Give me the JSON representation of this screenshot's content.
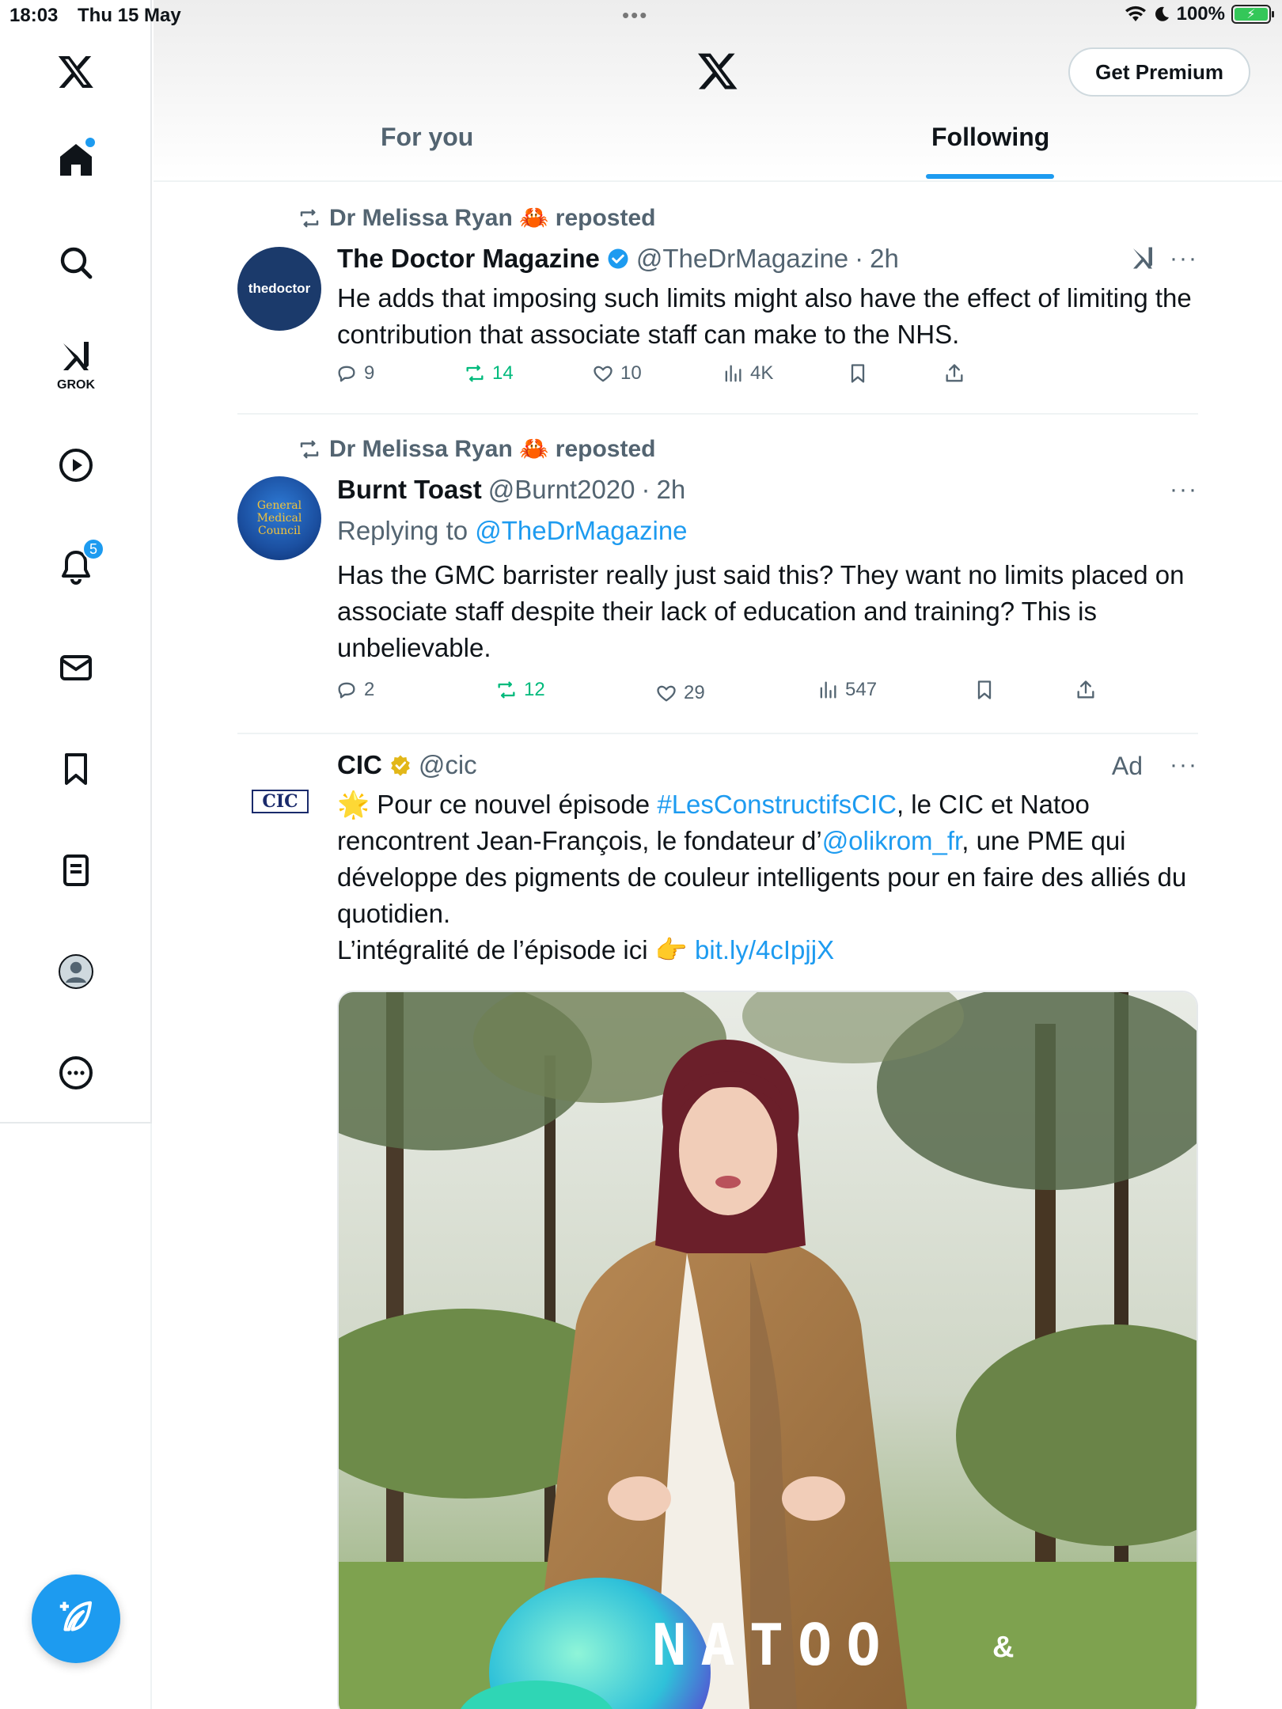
{
  "status_bar": {
    "time": "18:03",
    "date": "Thu 15 May",
    "battery": "100%"
  },
  "nav": {
    "grok_label": "GROK",
    "notifications_count": "5"
  },
  "header": {
    "premium_label": "Get Premium",
    "tabs": [
      {
        "label": "For you",
        "active": false
      },
      {
        "label": "Following",
        "active": true
      }
    ]
  },
  "tweets": [
    {
      "reposted_by": "Dr Melissa Ryan 🦀 reposted",
      "avatar_text": "thedoctor",
      "name": "The Doctor Magazine",
      "handle": "@TheDrMagazine",
      "time": "2h",
      "text": "He adds that imposing such limits might also have the effect of limiting the contribution that associate staff can make to the NHS.",
      "replies": "9",
      "reposts": "14",
      "likes": "10",
      "views": "4K"
    },
    {
      "reposted_by": "Dr Melissa Ryan 🦀 reposted",
      "avatar_text": "General Medical Council",
      "name": "Burnt Toast",
      "handle": "@Burnt2020",
      "time": "2h",
      "replying_prefix": "Replying to ",
      "replying_to": "@TheDrMagazine",
      "text": "Has the GMC barrister really just said this? They want no limits placed on associate staff despite their lack of education and training? This is unbelievable.",
      "replies": "2",
      "reposts": "12",
      "likes": "29",
      "views": "547"
    },
    {
      "avatar_text": "CIC",
      "name": "CIC",
      "handle": "@cic",
      "ad_label": "Ad",
      "text_parts": {
        "p1": "🌟 Pour ce nouvel épisode ",
        "hashtag": "#LesConstructifsCIC",
        "p2": ", le CIC et Natoo rencontrent Jean-François, le fondateur d’",
        "mention": "@olikrom_fr",
        "p3": ", une PME qui développe des pigments de couleur intelligents pour en faire des alliés du quotidien.",
        "p4": "L’intégralité de l’épisode ici 👉 ",
        "url": "bit.ly/4cIpjjX"
      },
      "media_overlay": "NATOO",
      "media_overlay_amp": "&"
    }
  ],
  "colors": {
    "accent": "#1d9bf0",
    "repost_green": "#00ba7c",
    "secondary_text": "#536471"
  }
}
